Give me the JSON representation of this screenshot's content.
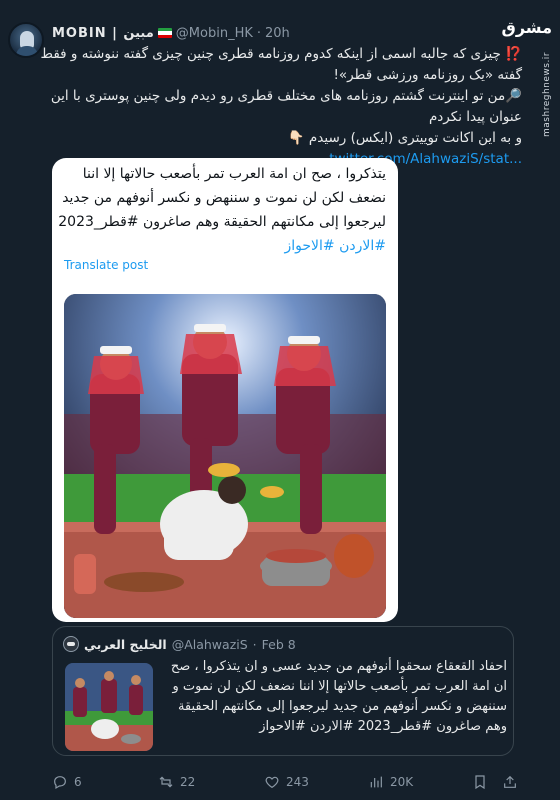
{
  "header": {
    "display_name": "MOBIN | مبین",
    "handle": "@Mobin_HK",
    "dot": "·",
    "time": "20h"
  },
  "watermark": {
    "logo": "مشرق",
    "site": "mashreghnews.ir"
  },
  "tweet": {
    "lines": [
      "⁉️ چیزی که جالبه اسمی از اینکه کدوم روزنامه قطری چنین چیزی گفته ننوشته و فقط",
      "گفته «یک روزنامه ورزشی قطر»!",
      "🔎من تو اینترنت گشتم روزنامه های مختلف قطری رو دیدم ولی چنین پوستری با این",
      "عنوان پیدا نکردم",
      "و به این اکانت توییتری (ایکس) رسیدم 👇🏻"
    ],
    "link": "twitter.com/AlahwaziS/stat..."
  },
  "card": {
    "lines": [
      "يتذكروا ، صح ان امة العرب تمر بأصعب حالاتها إلا اننا",
      "نضعف لكن لن نموت و سننهض و نكسر أنوفهم من جديد",
      "ليرجعوا إلى مكانتهم الحقيقة وهم صاغرون #قطر_2023"
    ],
    "hashtag_line": "#الاردن #الاحواز",
    "translate": "Translate post"
  },
  "quote": {
    "name": "الخليج العربي",
    "handle": "@AlahwaziS",
    "dot": "·",
    "date": "Feb 8",
    "lines": [
      "احفاد القعقاع سحقوا أنوفهم من جديد عسى و ان يتذكروا ، صح",
      "ان امة العرب تمر بأصعب حالاتها إلا اننا نضعف لكن لن نموت و",
      "سننهض و نكسر أنوفهم من جديد ليرجعوا إلى مكانتهم الحقيقة",
      "وهم صاغرون #قطر_2023 #الاردن #الاحواز"
    ]
  },
  "actions": {
    "replies": "6",
    "reposts": "22",
    "likes": "243",
    "views": "20K"
  },
  "colors": {
    "background": "#15202b",
    "text": "#e7e9ea",
    "muted": "#8b98a5",
    "link": "#1d9bf0",
    "border": "#38444d"
  }
}
